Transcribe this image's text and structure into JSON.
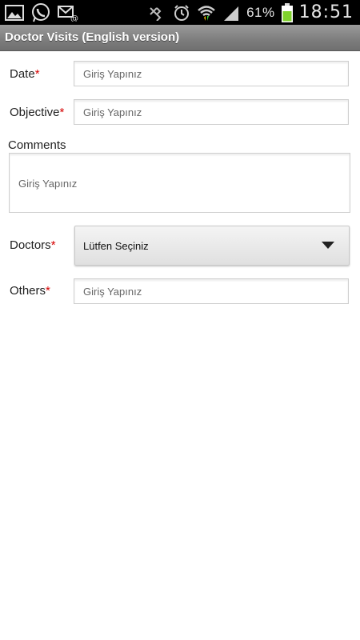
{
  "status_bar": {
    "battery_percent": "61%",
    "time": "18:51",
    "icons": [
      "gallery-icon",
      "whatsapp-icon",
      "email-icon",
      "bluetooth-icon",
      "alarm-icon",
      "wifi-icon",
      "signal-icon",
      "battery-icon"
    ],
    "battery_color": "#7fd22c"
  },
  "title_bar": {
    "title": "Doctor Visits (English version)"
  },
  "form": {
    "date": {
      "label": "Date",
      "required_mark": "*",
      "placeholder": "Giriş Yapınız"
    },
    "objective": {
      "label": "Objective",
      "required_mark": "*",
      "placeholder": "Giriş Yapınız"
    },
    "comments": {
      "label": "Comments",
      "placeholder": "Giriş Yapınız"
    },
    "doctors": {
      "label": "Doctors",
      "required_mark": "*",
      "selected": "Lütfen Seçiniz"
    },
    "others": {
      "label": "Others",
      "required_mark": "*",
      "placeholder": "Giriş Yapınız"
    }
  },
  "colors": {
    "required": "#d50000",
    "titlebar": "#7d7d7d"
  }
}
